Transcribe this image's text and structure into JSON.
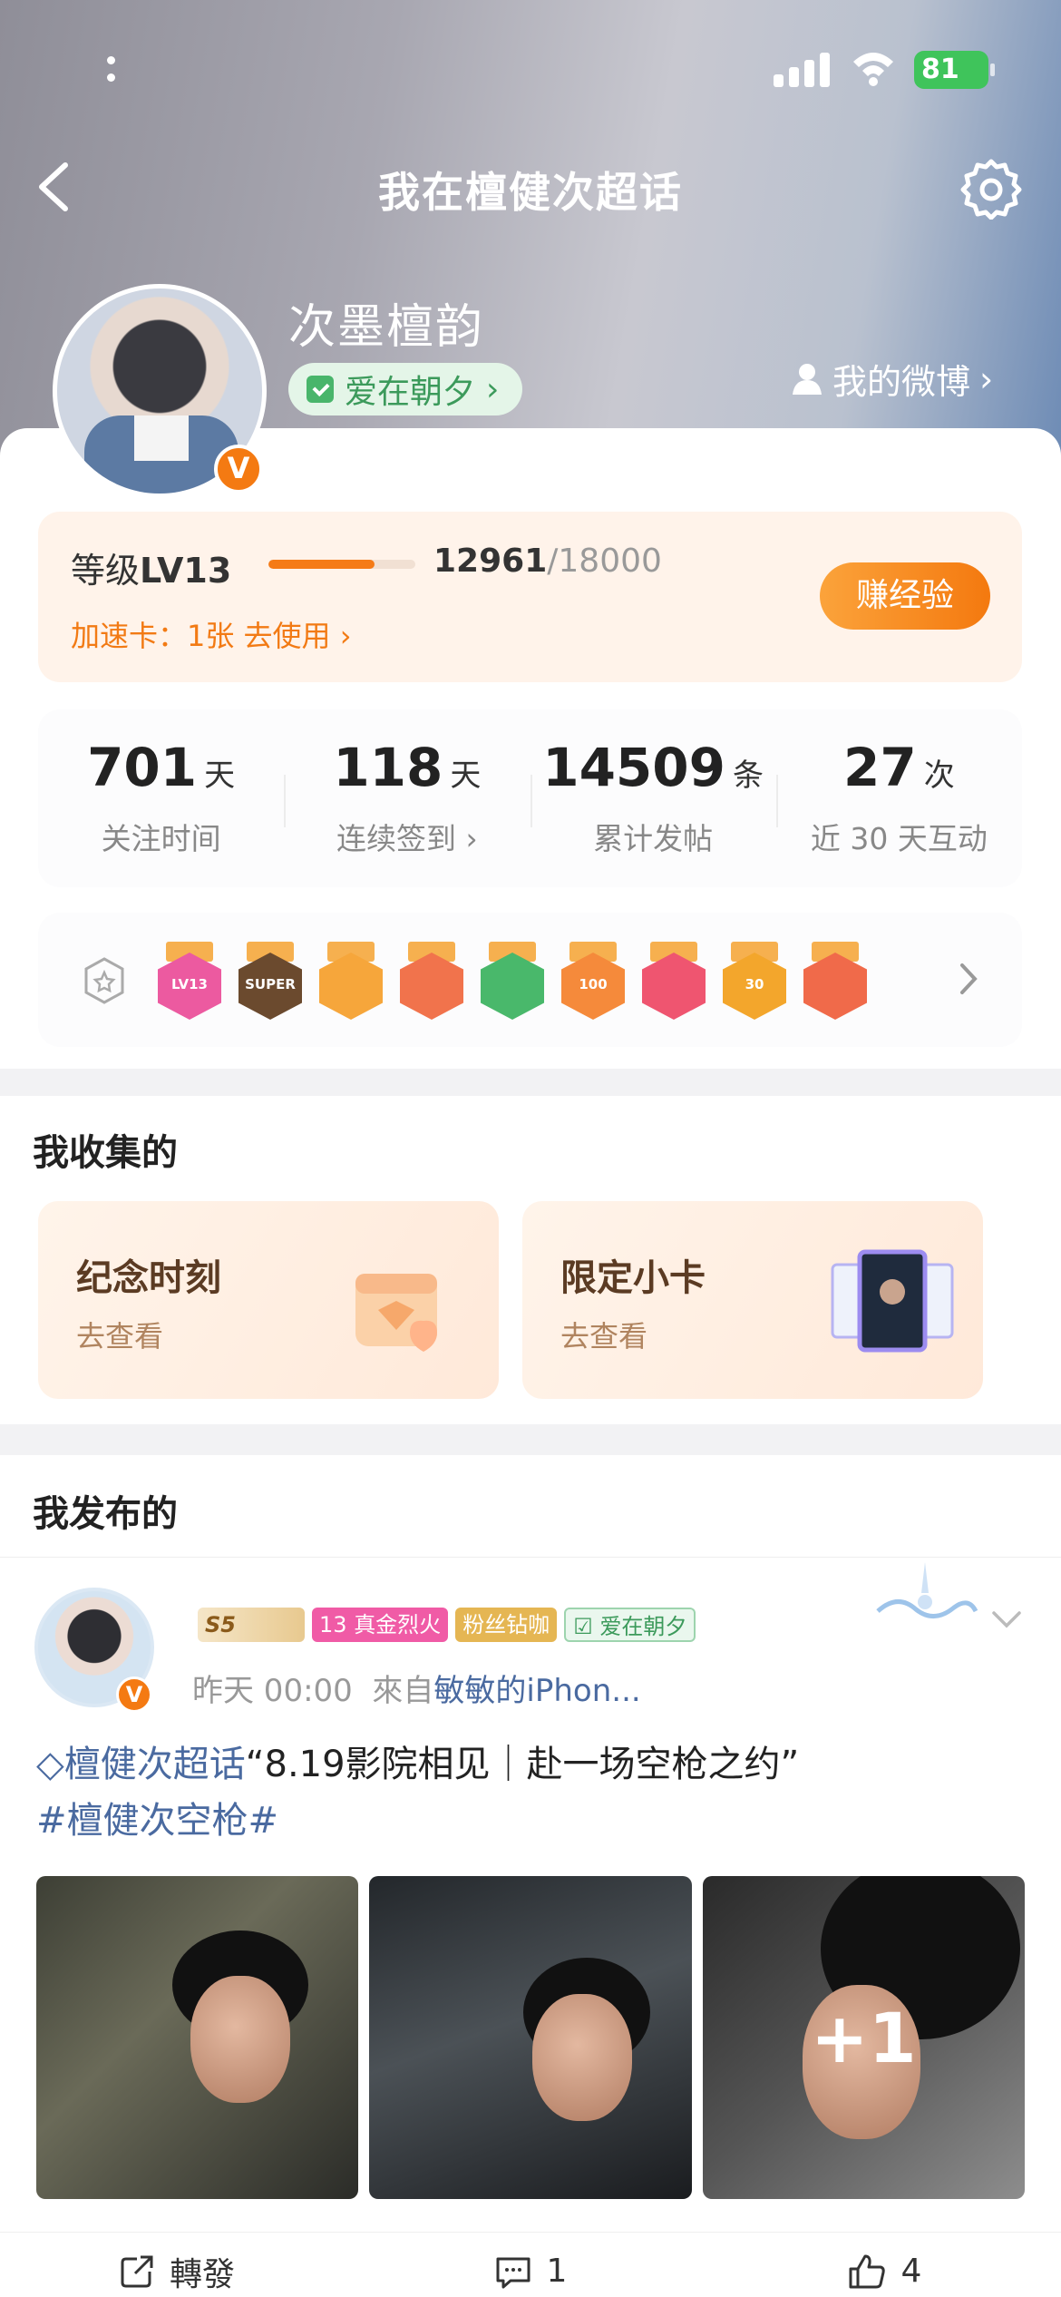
{
  "status_bar": {
    "battery": "81"
  },
  "nav": {
    "title": "我在檀健次超话"
  },
  "profile": {
    "name": "次墨檀韵",
    "love_pill": "爱在朝夕",
    "my_weibo": "我的微博",
    "verified_badge": "V"
  },
  "level": {
    "label_prefix": "等级",
    "level": "LV13",
    "progress": 0.72,
    "exp_current": "12961",
    "exp_total": "/18000",
    "speed_card": "加速卡：1张 去使用",
    "earn_button": "赚经验"
  },
  "stats": [
    {
      "value": "701",
      "unit": "天",
      "caption": "关注时间"
    },
    {
      "value": "118",
      "unit": "天",
      "caption": "连续签到"
    },
    {
      "value": "14509",
      "unit": "条",
      "caption": "累计发帖"
    },
    {
      "value": "27",
      "unit": "次",
      "caption": "近 30 天互动"
    }
  ],
  "badges": [
    {
      "icon": "lv-badge",
      "text": "LV13",
      "color": "#ec5aa0"
    },
    {
      "icon": "super-badge",
      "text": "SUPER",
      "color": "#6b4a2e"
    },
    {
      "icon": "crown-badge",
      "text": "",
      "color": "#f6a63b"
    },
    {
      "icon": "cat-badge",
      "text": "",
      "color": "#f1734c"
    },
    {
      "icon": "hand-badge",
      "text": "",
      "color": "#49b86b"
    },
    {
      "icon": "100days-badge",
      "text": "100",
      "color": "#f58a3b"
    },
    {
      "icon": "trophy-badge",
      "text": "",
      "color": "#ef5570"
    },
    {
      "icon": "30days-badge",
      "text": "30",
      "color": "#f3a62c"
    },
    {
      "icon": "bunny-badge",
      "text": "",
      "color": "#f06a4a"
    }
  ],
  "collection": {
    "title": "我收集的",
    "items": [
      {
        "title": "纪念时刻",
        "subtitle": "去查看"
      },
      {
        "title": "限定小卡",
        "subtitle": "去查看"
      }
    ]
  },
  "published": {
    "title": "我发布的"
  },
  "post": {
    "tags": [
      "S5",
      "13",
      "真金烈火",
      "粉丝钻咖",
      "爱在朝夕"
    ],
    "time": "昨天 00:00",
    "source_prefix": "來自",
    "source": "敏敏的iPhon...",
    "topic": "檀健次超话",
    "text": "“8.19影院相见｜赴一场空枪之约”",
    "hashtag": "#檀健次空枪#",
    "more_images": "+1",
    "actions": {
      "repost": "轉發",
      "comments": "1",
      "likes": "4"
    }
  }
}
